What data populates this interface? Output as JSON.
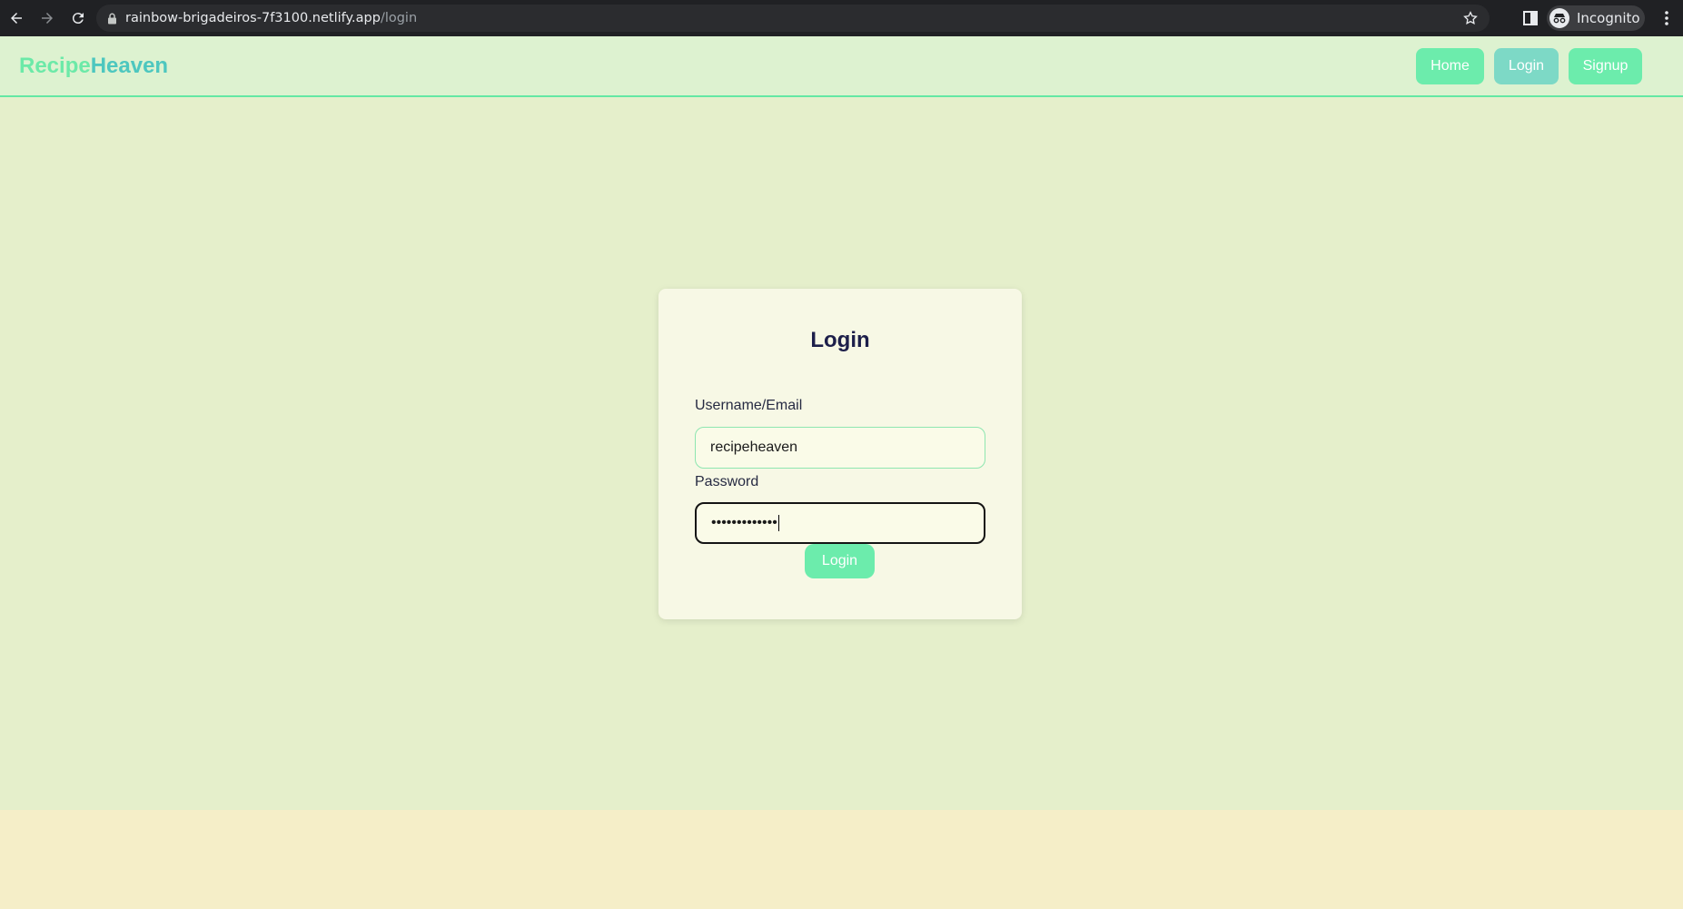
{
  "browser": {
    "url_host": "rainbow-brigadeiros-7f3100.netlify.app",
    "url_path": "/login",
    "profile_label": "Incognito"
  },
  "site": {
    "brand_part1": "Recipe",
    "brand_part2": "Heaven",
    "nav": {
      "home_label": "Home",
      "login_label": "Login",
      "signup_label": "Signup"
    }
  },
  "login_form": {
    "title": "Login",
    "username_label": "Username/Email",
    "username_value": "recipeheaven",
    "password_label": "Password",
    "password_masked": "•••••••••••••",
    "submit_label": "Login"
  },
  "colors": {
    "accent": "#6cecac",
    "active_nav": "#7dd9c6",
    "brand_secondary": "#4dc7bf",
    "page_bg": "#e5efcb",
    "footer_bg": "#f5eec8"
  }
}
